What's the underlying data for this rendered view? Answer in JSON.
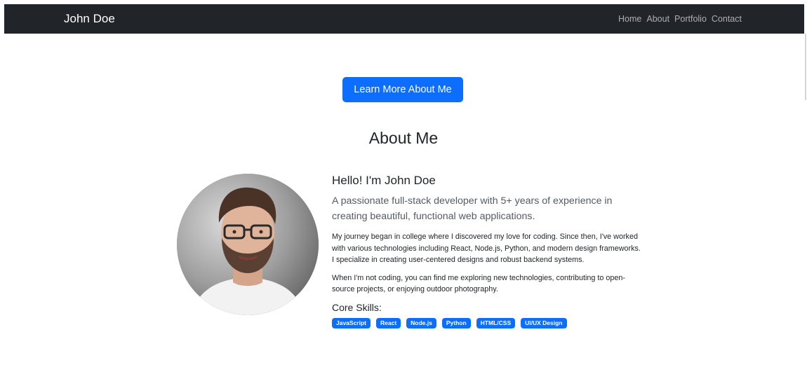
{
  "navbar": {
    "brand": "John Doe",
    "links": [
      "Home",
      "About",
      "Portfolio",
      "Contact"
    ]
  },
  "hero": {
    "button_label": "Learn More About Me"
  },
  "about": {
    "title": "About Me",
    "greeting": "Hello! I'm John Doe",
    "lead": "A passionate full-stack developer with 5+ years of experience in creating beautiful, functional web applications.",
    "paragraphs": [
      "My journey began in college where I discovered my love for coding. Since then, I've worked with various technologies including React, Node.js, Python, and modern design frameworks. I specialize in creating user-centered designs and robust backend systems.",
      "When I'm not coding, you can find me exploring new technologies, contributing to open-source projects, or enjoying outdoor photography."
    ],
    "skills_title": "Core Skills:",
    "skills": [
      "JavaScript",
      "React",
      "Node.js",
      "Python",
      "HTML/CSS",
      "UI/UX Design"
    ]
  },
  "colors": {
    "navbar_bg": "#212529",
    "primary": "#0d6efd"
  }
}
